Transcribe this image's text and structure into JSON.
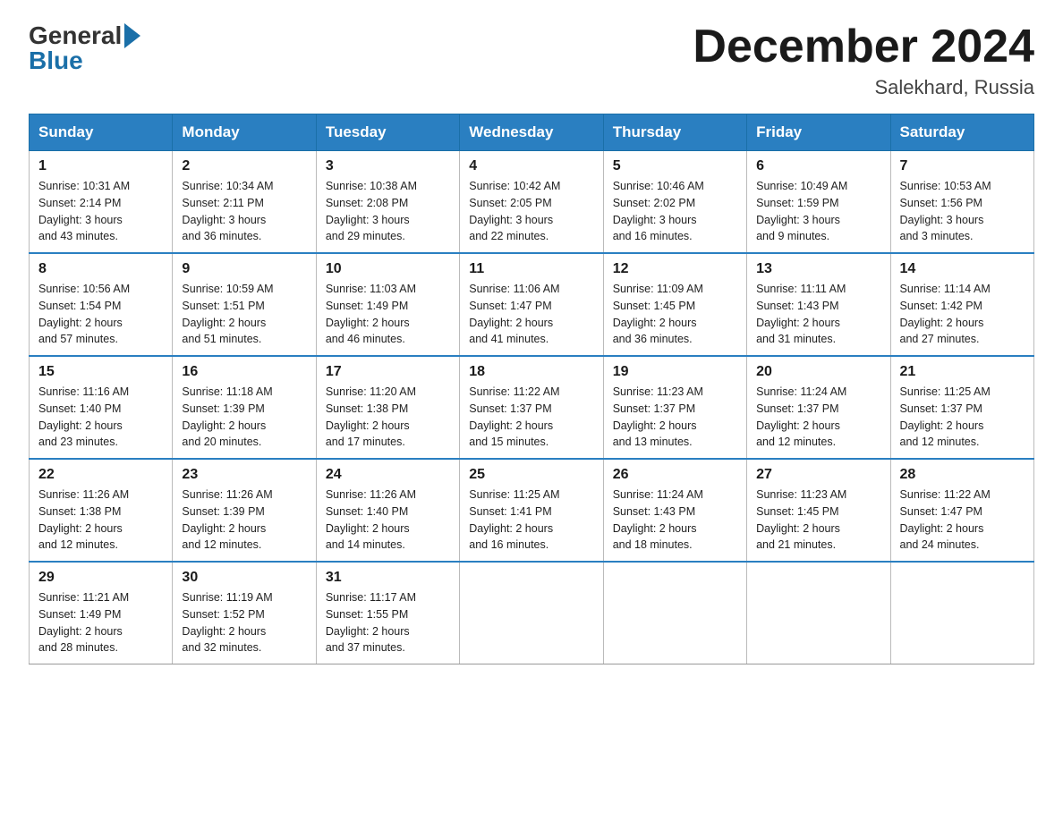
{
  "logo": {
    "general": "General",
    "blue": "Blue"
  },
  "title": "December 2024",
  "location": "Salekhard, Russia",
  "days_of_week": [
    "Sunday",
    "Monday",
    "Tuesday",
    "Wednesday",
    "Thursday",
    "Friday",
    "Saturday"
  ],
  "weeks": [
    [
      {
        "day": "1",
        "sunrise": "Sunrise: 10:31 AM",
        "sunset": "Sunset: 2:14 PM",
        "daylight": "Daylight: 3 hours",
        "daylight2": "and 43 minutes."
      },
      {
        "day": "2",
        "sunrise": "Sunrise: 10:34 AM",
        "sunset": "Sunset: 2:11 PM",
        "daylight": "Daylight: 3 hours",
        "daylight2": "and 36 minutes."
      },
      {
        "day": "3",
        "sunrise": "Sunrise: 10:38 AM",
        "sunset": "Sunset: 2:08 PM",
        "daylight": "Daylight: 3 hours",
        "daylight2": "and 29 minutes."
      },
      {
        "day": "4",
        "sunrise": "Sunrise: 10:42 AM",
        "sunset": "Sunset: 2:05 PM",
        "daylight": "Daylight: 3 hours",
        "daylight2": "and 22 minutes."
      },
      {
        "day": "5",
        "sunrise": "Sunrise: 10:46 AM",
        "sunset": "Sunset: 2:02 PM",
        "daylight": "Daylight: 3 hours",
        "daylight2": "and 16 minutes."
      },
      {
        "day": "6",
        "sunrise": "Sunrise: 10:49 AM",
        "sunset": "Sunset: 1:59 PM",
        "daylight": "Daylight: 3 hours",
        "daylight2": "and 9 minutes."
      },
      {
        "day": "7",
        "sunrise": "Sunrise: 10:53 AM",
        "sunset": "Sunset: 1:56 PM",
        "daylight": "Daylight: 3 hours",
        "daylight2": "and 3 minutes."
      }
    ],
    [
      {
        "day": "8",
        "sunrise": "Sunrise: 10:56 AM",
        "sunset": "Sunset: 1:54 PM",
        "daylight": "Daylight: 2 hours",
        "daylight2": "and 57 minutes."
      },
      {
        "day": "9",
        "sunrise": "Sunrise: 10:59 AM",
        "sunset": "Sunset: 1:51 PM",
        "daylight": "Daylight: 2 hours",
        "daylight2": "and 51 minutes."
      },
      {
        "day": "10",
        "sunrise": "Sunrise: 11:03 AM",
        "sunset": "Sunset: 1:49 PM",
        "daylight": "Daylight: 2 hours",
        "daylight2": "and 46 minutes."
      },
      {
        "day": "11",
        "sunrise": "Sunrise: 11:06 AM",
        "sunset": "Sunset: 1:47 PM",
        "daylight": "Daylight: 2 hours",
        "daylight2": "and 41 minutes."
      },
      {
        "day": "12",
        "sunrise": "Sunrise: 11:09 AM",
        "sunset": "Sunset: 1:45 PM",
        "daylight": "Daylight: 2 hours",
        "daylight2": "and 36 minutes."
      },
      {
        "day": "13",
        "sunrise": "Sunrise: 11:11 AM",
        "sunset": "Sunset: 1:43 PM",
        "daylight": "Daylight: 2 hours",
        "daylight2": "and 31 minutes."
      },
      {
        "day": "14",
        "sunrise": "Sunrise: 11:14 AM",
        "sunset": "Sunset: 1:42 PM",
        "daylight": "Daylight: 2 hours",
        "daylight2": "and 27 minutes."
      }
    ],
    [
      {
        "day": "15",
        "sunrise": "Sunrise: 11:16 AM",
        "sunset": "Sunset: 1:40 PM",
        "daylight": "Daylight: 2 hours",
        "daylight2": "and 23 minutes."
      },
      {
        "day": "16",
        "sunrise": "Sunrise: 11:18 AM",
        "sunset": "Sunset: 1:39 PM",
        "daylight": "Daylight: 2 hours",
        "daylight2": "and 20 minutes."
      },
      {
        "day": "17",
        "sunrise": "Sunrise: 11:20 AM",
        "sunset": "Sunset: 1:38 PM",
        "daylight": "Daylight: 2 hours",
        "daylight2": "and 17 minutes."
      },
      {
        "day": "18",
        "sunrise": "Sunrise: 11:22 AM",
        "sunset": "Sunset: 1:37 PM",
        "daylight": "Daylight: 2 hours",
        "daylight2": "and 15 minutes."
      },
      {
        "day": "19",
        "sunrise": "Sunrise: 11:23 AM",
        "sunset": "Sunset: 1:37 PM",
        "daylight": "Daylight: 2 hours",
        "daylight2": "and 13 minutes."
      },
      {
        "day": "20",
        "sunrise": "Sunrise: 11:24 AM",
        "sunset": "Sunset: 1:37 PM",
        "daylight": "Daylight: 2 hours",
        "daylight2": "and 12 minutes."
      },
      {
        "day": "21",
        "sunrise": "Sunrise: 11:25 AM",
        "sunset": "Sunset: 1:37 PM",
        "daylight": "Daylight: 2 hours",
        "daylight2": "and 12 minutes."
      }
    ],
    [
      {
        "day": "22",
        "sunrise": "Sunrise: 11:26 AM",
        "sunset": "Sunset: 1:38 PM",
        "daylight": "Daylight: 2 hours",
        "daylight2": "and 12 minutes."
      },
      {
        "day": "23",
        "sunrise": "Sunrise: 11:26 AM",
        "sunset": "Sunset: 1:39 PM",
        "daylight": "Daylight: 2 hours",
        "daylight2": "and 12 minutes."
      },
      {
        "day": "24",
        "sunrise": "Sunrise: 11:26 AM",
        "sunset": "Sunset: 1:40 PM",
        "daylight": "Daylight: 2 hours",
        "daylight2": "and 14 minutes."
      },
      {
        "day": "25",
        "sunrise": "Sunrise: 11:25 AM",
        "sunset": "Sunset: 1:41 PM",
        "daylight": "Daylight: 2 hours",
        "daylight2": "and 16 minutes."
      },
      {
        "day": "26",
        "sunrise": "Sunrise: 11:24 AM",
        "sunset": "Sunset: 1:43 PM",
        "daylight": "Daylight: 2 hours",
        "daylight2": "and 18 minutes."
      },
      {
        "day": "27",
        "sunrise": "Sunrise: 11:23 AM",
        "sunset": "Sunset: 1:45 PM",
        "daylight": "Daylight: 2 hours",
        "daylight2": "and 21 minutes."
      },
      {
        "day": "28",
        "sunrise": "Sunrise: 11:22 AM",
        "sunset": "Sunset: 1:47 PM",
        "daylight": "Daylight: 2 hours",
        "daylight2": "and 24 minutes."
      }
    ],
    [
      {
        "day": "29",
        "sunrise": "Sunrise: 11:21 AM",
        "sunset": "Sunset: 1:49 PM",
        "daylight": "Daylight: 2 hours",
        "daylight2": "and 28 minutes."
      },
      {
        "day": "30",
        "sunrise": "Sunrise: 11:19 AM",
        "sunset": "Sunset: 1:52 PM",
        "daylight": "Daylight: 2 hours",
        "daylight2": "and 32 minutes."
      },
      {
        "day": "31",
        "sunrise": "Sunrise: 11:17 AM",
        "sunset": "Sunset: 1:55 PM",
        "daylight": "Daylight: 2 hours",
        "daylight2": "and 37 minutes."
      },
      null,
      null,
      null,
      null
    ]
  ]
}
